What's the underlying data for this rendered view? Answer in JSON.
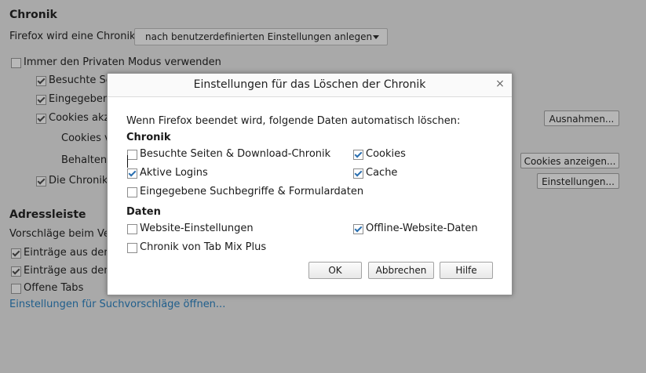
{
  "bg": {
    "chronik_heading": "Chronik",
    "history_label": "Firefox wird eine Chronik:",
    "history_select": "nach benutzerdefinierten Einstellungen anlegen",
    "private_mode": "Immer den Privaten Modus verwenden",
    "visited": "Besuchte Se",
    "entered": "Eingegebene",
    "cookies": "Cookies akze",
    "cookies_from": "Cookies v",
    "keep": "Behalten,",
    "die_chronik": "Die Chronik",
    "ausnahmen_btn": "Ausnahmen...",
    "cookies_anzeigen_btn": "Cookies anzeigen...",
    "einstellungen_btn": "Einstellungen...",
    "adressleiste_heading": "Adressleiste",
    "vorschlaege": "Vorschläge beim Ver",
    "eintraege1": "Einträge aus der C",
    "eintraege2": "Einträge aus den l",
    "offene_tabs": "Offene Tabs",
    "suchvorschlaege_link": "Einstellungen für Suchvorschläge öffnen..."
  },
  "dialog": {
    "title": "Einstellungen für das Löschen der Chronik",
    "close": "×",
    "intro": "Wenn Firefox beendet wird, folgende Daten automatisch löschen:",
    "section_chronik": "Chronik",
    "section_daten": "Daten",
    "items": {
      "besuchte": "Besuchte Seiten & Download-Chronik",
      "cookies": "Cookies",
      "logins": "Aktive Logins",
      "cache": "Cache",
      "suchbegriffe": "Eingegebene Suchbegriffe & Formulardaten",
      "website_einstellungen": "Website-Einstellungen",
      "offline": "Offline-Website-Daten",
      "tabmix": "Chronik von Tab Mix Plus"
    },
    "checked": {
      "besuchte": false,
      "cookies": true,
      "logins": true,
      "cache": true,
      "suchbegriffe": false,
      "website_einstellungen": false,
      "offline": true,
      "tabmix": false
    },
    "buttons": {
      "ok": "OK",
      "abbrechen": "Abbrechen",
      "hilfe": "Hilfe"
    }
  }
}
